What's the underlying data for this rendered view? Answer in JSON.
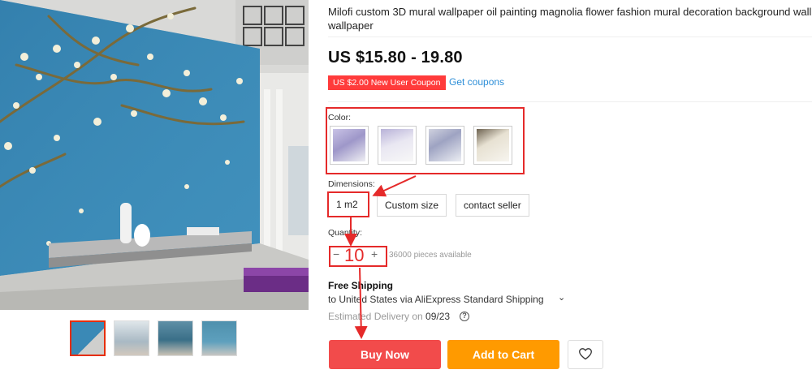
{
  "product": {
    "title": "Milofi custom 3D mural wallpaper oil painting magnolia flower fashion mural decoration background wall wallpaper",
    "price": "US $15.80 - 19.80",
    "coupon_badge": "US $2.00 New User Coupon",
    "coupon_link": "Get coupons"
  },
  "gallery": {
    "thumbnails": [
      "thumb-1",
      "thumb-2",
      "thumb-3",
      "thumb-4"
    ],
    "active_index": 0
  },
  "options": {
    "color_label": "Color:",
    "dimensions_label": "Dimensions:",
    "dimensions": [
      "1 m2",
      "Custom size",
      "contact seller"
    ],
    "selected_dimension": "1 m2"
  },
  "quantity": {
    "label": "Quantity:",
    "minus": "−",
    "value": "10",
    "plus": "+",
    "available": "36000 pieces available"
  },
  "shipping": {
    "title": "Free Shipping",
    "route": "to United States via AliExpress Standard Shipping",
    "caret": "⌄",
    "delivery_prefix": "Estimated Delivery on ",
    "delivery_date": "09/23",
    "help_icon": "?"
  },
  "actions": {
    "buy_now": "Buy Now",
    "add_to_cart": "Add to Cart"
  },
  "colors": {
    "accent_red": "#e52a2a",
    "buy_red": "#f24b4b",
    "cart_orange": "#ff9a00",
    "link_blue": "#2e8fd8",
    "wall_blue": "#3a89b6"
  },
  "icons": [
    "minus-icon",
    "plus-icon",
    "chevron-down-icon",
    "help-icon",
    "heart-icon"
  ]
}
